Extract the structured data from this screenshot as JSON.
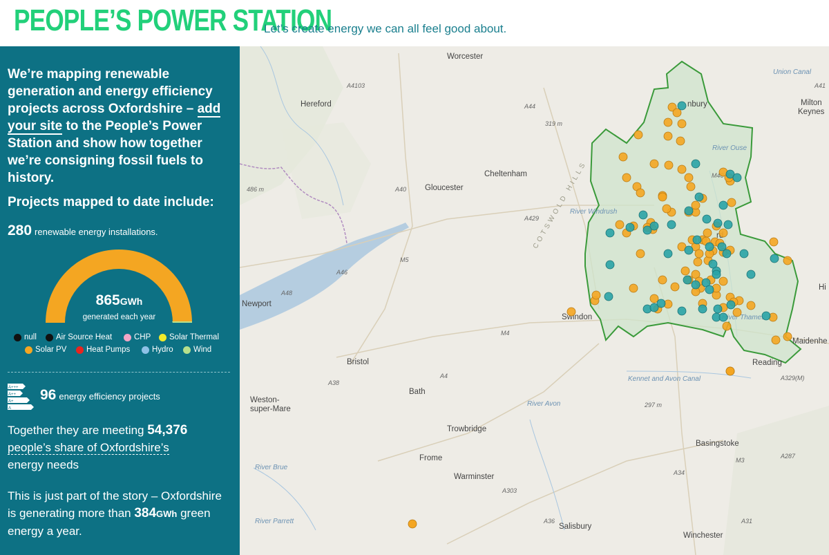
{
  "header": {
    "title": "PEOPLE’S POWER STATION",
    "tagline": "Let’s create energy we can all feel good about."
  },
  "sidebar": {
    "intro_pre": "We’re mapping renewable generation and energy efficiency projects across Oxfordshire – ",
    "intro_link": "add your site",
    "intro_post": " to the People’s Power Station and show how together we’re consigning fossil fuels to history.",
    "projects_title": "Projects mapped to date include:",
    "renewables_count": "280",
    "renewables_label": "renewable energy installations.",
    "gauge_value": "865",
    "gauge_unit": "GWh",
    "gauge_label": "generated each year",
    "legend": [
      {
        "label": "null",
        "color": "#111111"
      },
      {
        "label": "Air Source Heat",
        "color": "#111111"
      },
      {
        "label": "CHP",
        "color": "#f2a6c6"
      },
      {
        "label": "Solar Thermal",
        "color": "#f0ea2a"
      },
      {
        "label": "Solar PV",
        "color": "#f4a622"
      },
      {
        "label": "Heat Pumps",
        "color": "#e8241f"
      },
      {
        "label": "Hydro",
        "color": "#8ec1e6"
      },
      {
        "label": "Wind",
        "color": "#b7e08c"
      }
    ],
    "efficiency_count": "96",
    "efficiency_label": "energy efficiency projects",
    "efficiency_icon_labels": [
      "A+++",
      "A++",
      "A+",
      "A"
    ],
    "meeting_pre": "Together they are meeting ",
    "meeting_value": "54,376",
    "meeting_link": "people’s share of Oxfordshire’s",
    "meeting_post": "energy needs",
    "story_pre": "This is just part of the story – Oxfordshire is generating more than ",
    "story_value": "384",
    "story_unit": "GWh",
    "story_post": " green energy a year."
  },
  "map": {
    "places": [
      "Worcester",
      "Hereford",
      "Cheltenham",
      "Gloucester",
      "Newport",
      "Bristol",
      "Bath",
      "Weston-",
      "super-Mare",
      "Trowbridge",
      "Frome",
      "Warminster",
      "Salisbury",
      "Winchester",
      "Basingstoke",
      "Reading",
      "Maidenhe",
      "Swindon",
      "Milton",
      "Keynes",
      "nbury",
      "rd",
      "Hi"
    ],
    "roads": [
      "A4103",
      "A44",
      "A40",
      "A429",
      "A46",
      "M5",
      "A48",
      "A4",
      "A38",
      "M4",
      "A303",
      "A36",
      "A31",
      "M3",
      "A34",
      "A287",
      "A329(M)",
      "M40",
      "A41"
    ],
    "water": [
      "River Ouse",
      "River Windrush",
      "River Avon",
      "Kennet and Avon Canal",
      "River Brue",
      "River Parrett",
      "River Thames",
      "Union Canal"
    ],
    "elevations": [
      "319 m",
      "486 m",
      "297 m"
    ],
    "hills": "COTSWOLD HILLS",
    "solar_color": "#f4a622",
    "other_color": "#2aa3a6"
  }
}
